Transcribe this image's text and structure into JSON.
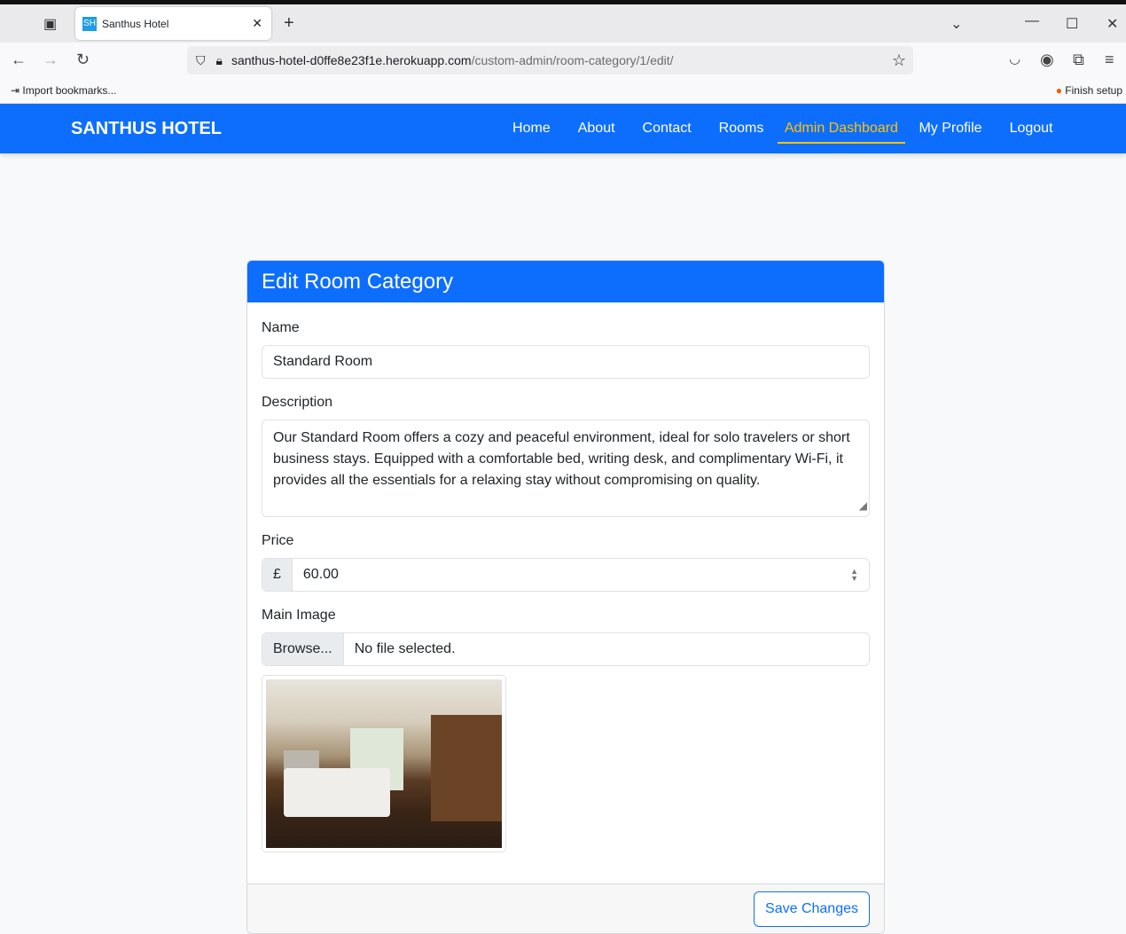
{
  "browser": {
    "tab_title": "Santhus Hotel",
    "favicon": "SH",
    "url_host": "santhus-hotel-d0ffe8e23f1e.herokuapp.com",
    "url_path": "/custom-admin/room-category/1/edit/",
    "import_bookmarks": "Import bookmarks...",
    "finish_setup": "Finish setup"
  },
  "nav": {
    "brand": "SANTHUS HOTEL",
    "links": [
      "Home",
      "About",
      "Contact",
      "Rooms",
      "Admin Dashboard",
      "My Profile",
      "Logout"
    ]
  },
  "form": {
    "title": "Edit Room Category",
    "name_label": "Name",
    "name_value": "Standard Room",
    "desc_label": "Description",
    "desc_value": "Our Standard Room offers a cozy and peaceful environment, ideal for solo travelers or short business stays. Equipped with a comfortable bed, writing desk, and complimentary Wi-Fi, it provides all the essentials for a relaxing stay without compromising on quality.",
    "price_label": "Price",
    "currency": "£",
    "price_value": "60.00",
    "image_label": "Main Image",
    "browse": "Browse...",
    "no_file": "No file selected.",
    "save": "Save Changes"
  },
  "colors": {
    "primary": "#0d6efd",
    "active": "#ffc107"
  }
}
